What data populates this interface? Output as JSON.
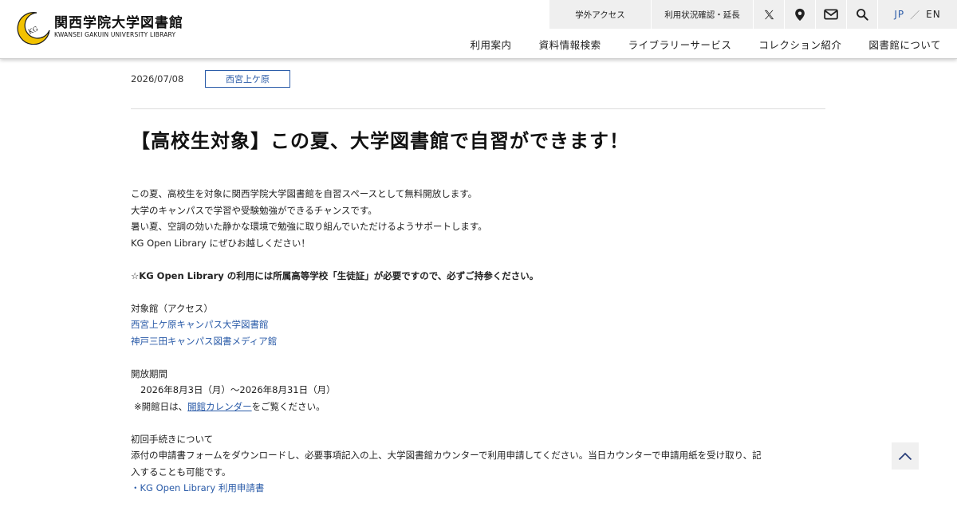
{
  "header": {
    "logo_ja": "関西学院大学図書館",
    "logo_en": "KWANSEI GAKUIN UNIVERSITY LIBRARY",
    "logo_mark_text": "KG",
    "top_links": {
      "access": "学外アクセス",
      "status": "利用状況確認・延長"
    },
    "icons": [
      "x-logo-icon",
      "map-pin-icon",
      "mail-icon",
      "search-icon"
    ],
    "lang": {
      "jp": "JP",
      "sep": "／",
      "en": "EN"
    },
    "nav": [
      "利用案内",
      "資料情報検索",
      "ライブラリーサービス",
      "コレクション紹介",
      "図書館について"
    ],
    "accent": "#2a5ba8",
    "logo_gold": "#f2c200"
  },
  "article": {
    "date": "2026/07/08",
    "tag": "西宮上ケ原",
    "title": "【高校生対象】この夏、大学図書館で自習ができます！",
    "intro": [
      "この夏、高校生を対象に関西学院大学図書館を自習スペースとして無料開放します。",
      "大学のキャンパスで学習や受験勉強ができるチャンスです。",
      "暑い夏、空調の効いた静かな環境で勉強に取り組んでいただけるようサポートします。",
      "KG Open Library にぜひお越しください！"
    ],
    "notice": "☆KG Open Library の利用には所属高等学校「生徒証」が必要ですので、必ずご持参ください。",
    "target_heading": "対象館（アクセス）",
    "target_links": [
      "西宮上ケ原キャンパス大学図書館",
      "神戸三田キャンパス図書メディア館"
    ],
    "period_heading": "開放期間",
    "period": "2026年8月3日（月）〜2026年8月31日（月）",
    "calendar_prefix": "※開館日は、",
    "calendar_link": "開館カレンダー",
    "calendar_suffix": "をご覧ください。",
    "procedure_heading": "初回手続きについて",
    "procedure_line1": "添付の申請書フォームをダウンロードし、必要事項記入の上、大学図書館カウンターで利用申請してください。当日カウンターで申請用紙を受け取り、記",
    "procedure_line2": "入することも可能です。",
    "form_link": "・KG Open Library 利用申請書"
  },
  "back_to_top": {
    "icon": "chevron-up-icon"
  }
}
